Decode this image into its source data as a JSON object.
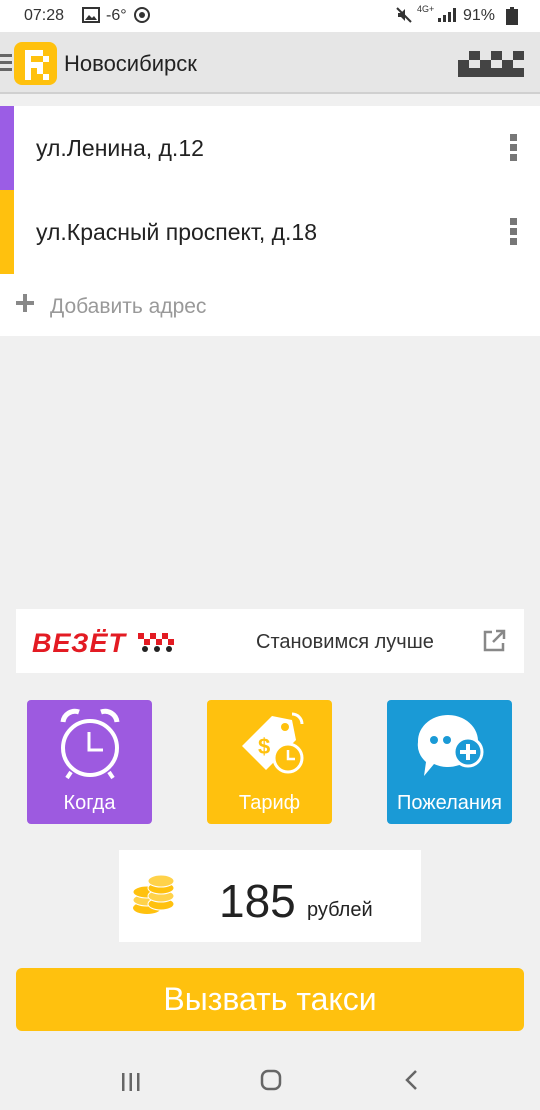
{
  "status_bar": {
    "time": "07:28",
    "temperature": "-6°",
    "network": "4G+",
    "battery": "91%",
    "icons": [
      "image-icon",
      "vpn-icon",
      "mute-icon",
      "signal-icon",
      "battery-icon"
    ]
  },
  "app_bar": {
    "city": "Новосибирск",
    "logo_icon": "app-logo-icon",
    "menu_icon": "menu-icon",
    "checker_icon": "taxi-checker-icon"
  },
  "addresses": [
    {
      "text": "ул.Ленина, д.12",
      "color": "#9b5de5"
    },
    {
      "text": "ул.Красный проспект, д.18",
      "color": "#ffc10e"
    }
  ],
  "add_address": {
    "label": "Добавить адрес",
    "icon": "plus-icon"
  },
  "promo": {
    "brand": "ВЕЗЁТ",
    "text": "Становимся лучше",
    "icon": "external-link-icon"
  },
  "tiles": [
    {
      "label": "Когда",
      "icon": "alarm-clock-icon",
      "color": "#9d5ae0"
    },
    {
      "label": "Тариф",
      "icon": "price-tag-icon",
      "color": "#ffc10e"
    },
    {
      "label": "Пожелания",
      "icon": "chat-add-icon",
      "color": "#1a9ad6"
    }
  ],
  "price": {
    "value": "185",
    "unit": "рублей",
    "icon": "coins-icon"
  },
  "call_button": {
    "label": "Вызвать такси",
    "color": "#ffc10e"
  },
  "nav_bar": {
    "icons": [
      "recents-icon",
      "home-icon",
      "back-icon"
    ]
  }
}
